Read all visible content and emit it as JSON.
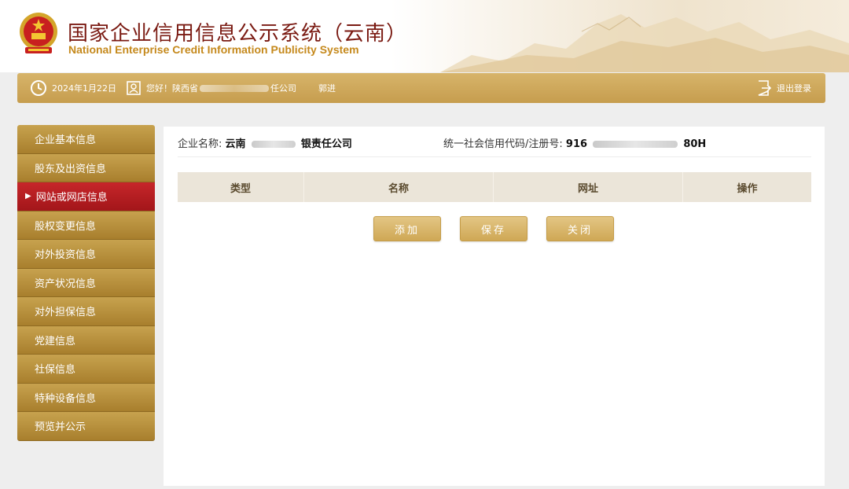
{
  "header": {
    "title_cn": "国家企业信用信息公示系统（云南）",
    "title_en": "National Enterprise Credit Information Publicity System",
    "emblem_icon": "national-emblem-icon"
  },
  "userbar": {
    "date": "2024年1月22日",
    "greeting_prefix": "您好！陕西省",
    "greeting_suffix": "任公司",
    "user_name": "郭进",
    "logout_label": "退出登录"
  },
  "sidebar": {
    "items": [
      {
        "label": "企业基本信息"
      },
      {
        "label": "股东及出资信息"
      },
      {
        "label": "网站或网店信息",
        "active": true
      },
      {
        "label": "股权变更信息"
      },
      {
        "label": "对外投资信息"
      },
      {
        "label": "资产状况信息"
      },
      {
        "label": "对外担保信息"
      },
      {
        "label": "党建信息"
      },
      {
        "label": "社保信息"
      },
      {
        "label": "特种设备信息"
      },
      {
        "label": "预览并公示"
      }
    ]
  },
  "main": {
    "company_label": "企业名称:",
    "company_prefix": "云南",
    "company_suffix": "银责任公司",
    "code_label": "统一社会信用代码/注册号:",
    "code_prefix": "916",
    "code_suffix": "80H",
    "table_headers": [
      "类型",
      "名称",
      "网址",
      "操作"
    ],
    "buttons": {
      "add": "添加",
      "save": "保存",
      "close": "关闭"
    }
  },
  "colors": {
    "gold": "#c69d4e",
    "active_red": "#b31b20",
    "title_red": "#7a1a12",
    "title_en_gold": "#c5891c"
  }
}
